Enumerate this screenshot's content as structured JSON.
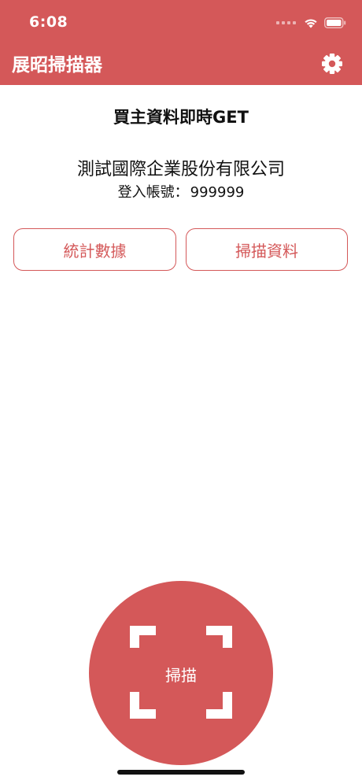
{
  "status_bar": {
    "time": "6:08"
  },
  "header": {
    "title": "展昭掃描器",
    "settings_icon": "gear-icon"
  },
  "main": {
    "headline": "買主資料即時GET",
    "company": "測試國際企業股份有限公司",
    "account_label": "登入帳號：",
    "account_value": "999999",
    "buttons": {
      "stats": "統計數據",
      "scan_data": "掃描資料"
    }
  },
  "scan_button": {
    "label": "掃描",
    "icon": "scan-frame-icon"
  },
  "colors": {
    "accent": "#d45859",
    "background": "#ffffff",
    "text": "#111111"
  }
}
